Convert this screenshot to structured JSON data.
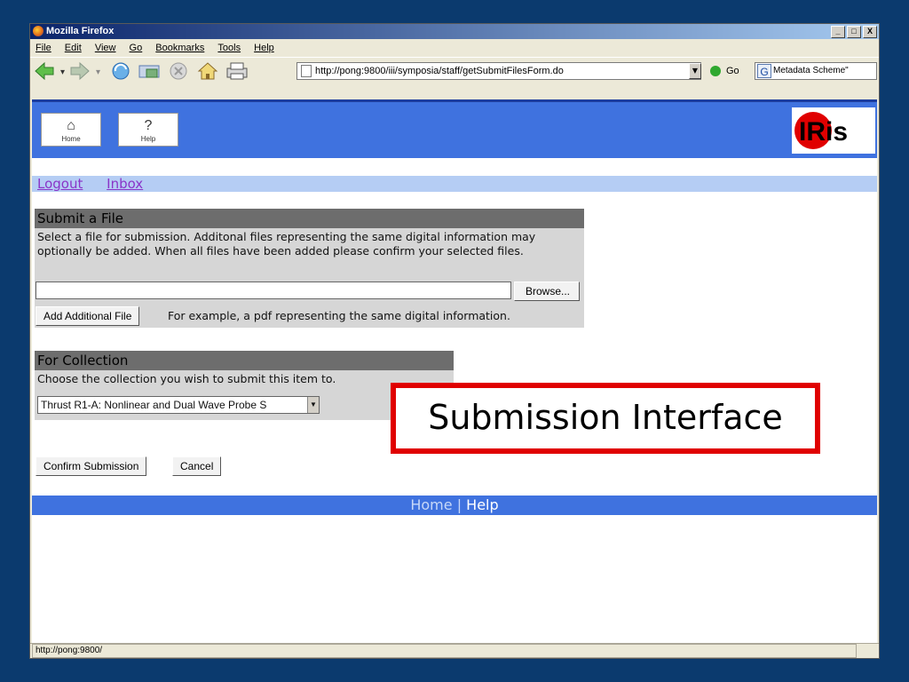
{
  "window": {
    "title": "Mozilla Firefox",
    "min": "_",
    "max": "□",
    "close": "X"
  },
  "menu": {
    "file": "File",
    "edit": "Edit",
    "view": "View",
    "go": "Go",
    "bookmarks": "Bookmarks",
    "tools": "Tools",
    "help": "Help"
  },
  "toolbar": {
    "url": "http://pong:9800/iii/symposia/staff/getSubmitFilesForm.do",
    "go_label": "Go",
    "search_value": "Metadata Scheme\""
  },
  "header": {
    "home_label": "Home",
    "help_label": "Help",
    "logo_text": "IRis"
  },
  "links": {
    "logout": "Logout",
    "inbox": "Inbox"
  },
  "submit_file": {
    "heading": "Submit a File",
    "description": "Select a file for submission. Additonal files representing the same digital information may optionally be added. When all files have been added please confirm your selected files.",
    "file_value": "",
    "browse_label": "Browse...",
    "add_label": "Add Additional File",
    "hint": "For example, a pdf representing the same digital information."
  },
  "collection": {
    "heading": "For Collection",
    "description": "Choose the collection you wish to submit this item to.",
    "selected": "Thrust R1-A: Nonlinear and Dual Wave Probe S"
  },
  "actions": {
    "confirm": "Confirm Submission",
    "cancel": "Cancel"
  },
  "footer": {
    "home": "Home",
    "sep": "|",
    "help": "Help"
  },
  "status": {
    "text": "http://pong:9800/"
  },
  "callout": {
    "text": "Submission Interface"
  },
  "colors": {
    "header_blue": "#3f72df",
    "links_bar": "#b5cdf4",
    "panel_gray": "#d6d6d6",
    "panel_head": "#6d6d6d",
    "callout_red": "#e00000",
    "background": "#0b3a6e"
  }
}
